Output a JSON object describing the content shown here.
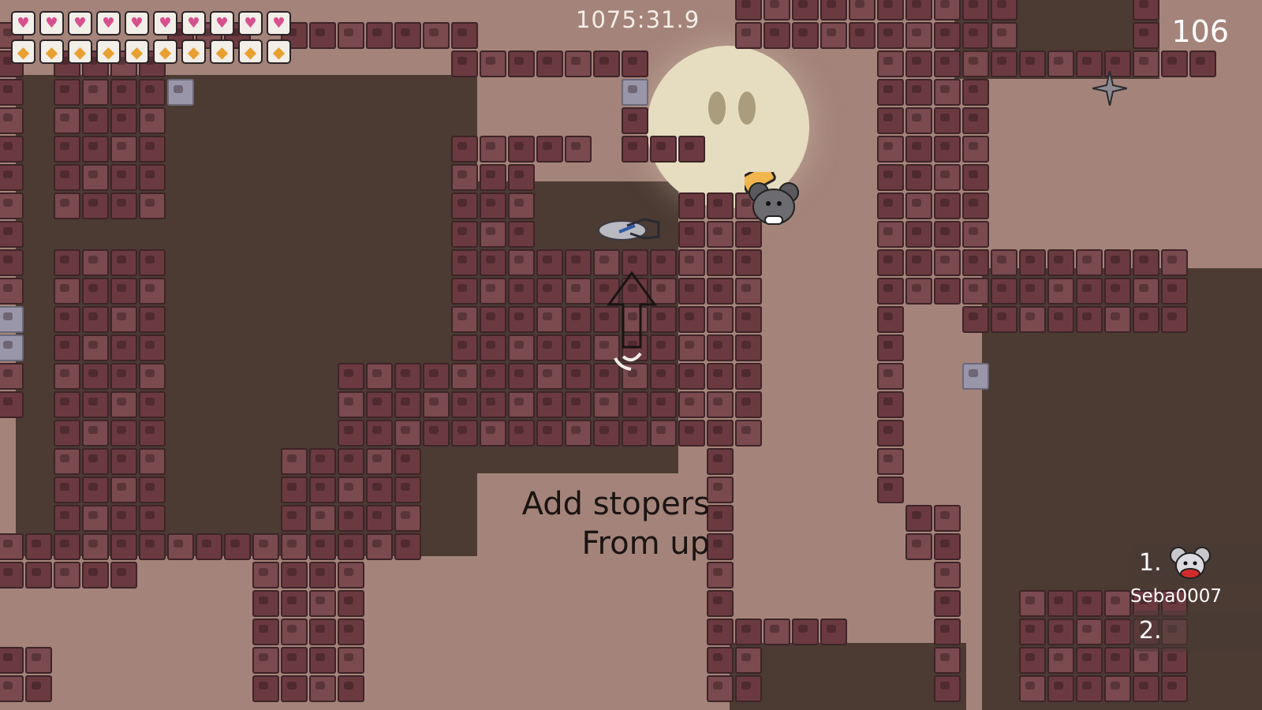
{
  "hud": {
    "timer": "1075:31.9",
    "score": "106",
    "hearts_filled": 10,
    "gems_filled": 10,
    "heart_icon": "heart-icon",
    "gem_icon": "gem-icon"
  },
  "level": {
    "hint_line1": "Add stopers",
    "hint_line2": "From up"
  },
  "leaderboard": {
    "entries": [
      {
        "rank": "1.",
        "name": "Seba0007"
      },
      {
        "rank": "2.",
        "name": ""
      }
    ]
  },
  "colors": {
    "sky": "#a4847a",
    "cave": "#4b3b33",
    "brick": "#6b3a40",
    "moon": "#e6dcc0"
  }
}
